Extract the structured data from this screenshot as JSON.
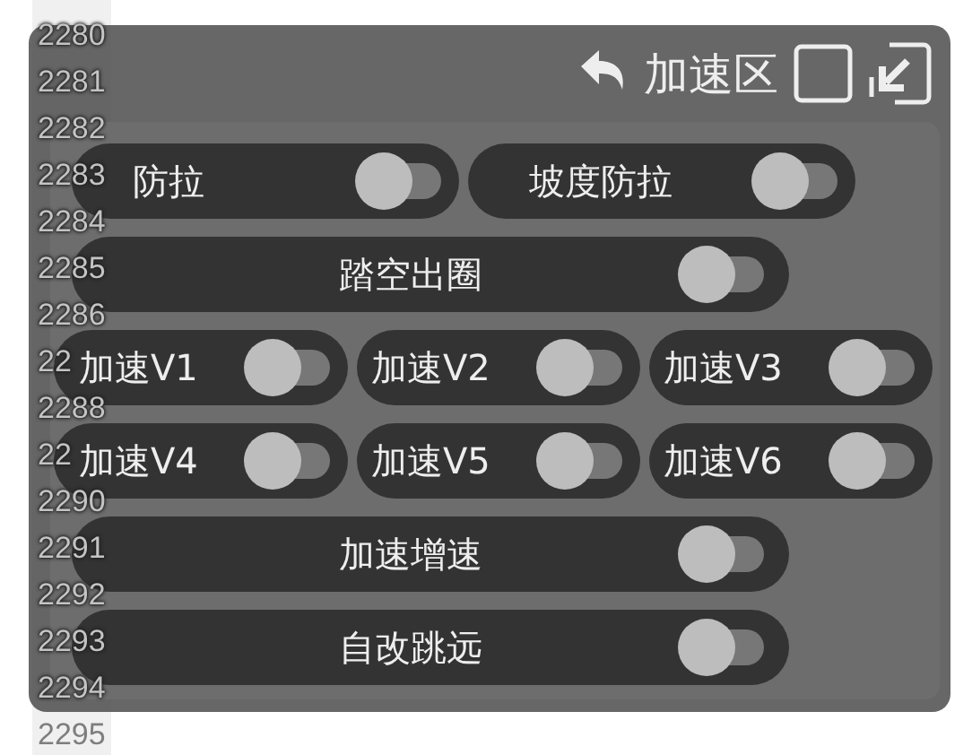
{
  "line_numbers": [
    "2280",
    "2281",
    "2282",
    "2283",
    "2284",
    "2285",
    "2286",
    "22",
    "2288",
    "22",
    "2290",
    "2291",
    "2292",
    "2293",
    "2294",
    "2295"
  ],
  "panel": {
    "title": "加速区",
    "rows": [
      {
        "items": [
          {
            "label": "防拉",
            "on": false
          },
          {
            "label": "坡度防拉",
            "on": false
          }
        ]
      },
      {
        "items": [
          {
            "label": "踏空出圈",
            "on": false
          }
        ]
      },
      {
        "items": [
          {
            "label": "加速V1",
            "on": false
          },
          {
            "label": "加速V2",
            "on": false
          },
          {
            "label": "加速V3",
            "on": false
          }
        ]
      },
      {
        "items": [
          {
            "label": "加速V4",
            "on": false
          },
          {
            "label": "加速V5",
            "on": false
          },
          {
            "label": "加速V6",
            "on": false
          }
        ]
      },
      {
        "items": [
          {
            "label": "加速增速",
            "on": false
          }
        ]
      },
      {
        "items": [
          {
            "label": "自改跳远",
            "on": false
          }
        ]
      }
    ]
  }
}
